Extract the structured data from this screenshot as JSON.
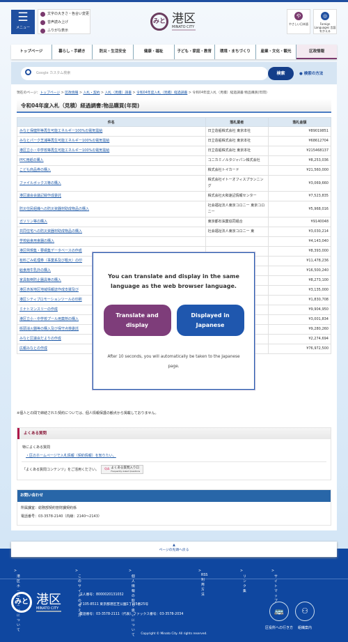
{
  "header": {
    "menu_label": "メニュー",
    "tools": [
      "文字の大きさ・色合い変更",
      "音声読み上げ",
      "ふりがな表示"
    ],
    "logo_name": "港区",
    "logo_sub": "MINATO CITY",
    "easy_japanese": "やさしい日本語",
    "foreign_languages": "Foreign Languages 言語をかえる"
  },
  "nav": [
    "トップページ",
    "暮らし・手続き",
    "防災・生活安全",
    "健康・福祉",
    "子ども・家庭・教育",
    "環境・まちづくり",
    "産業・文化・観光",
    "区政情報"
  ],
  "search": {
    "placeholder": "Google カスタム検索",
    "button": "検索",
    "how": "検索の方法"
  },
  "breadcrumb": {
    "prefix": "現在のページ：",
    "links": [
      "トップページ",
      "区政情報",
      "入札・契約",
      "入札（見積）調書",
      "令和04年度入札（見積）経過調書"
    ],
    "current": "令和04年度入札（見積）経過調書:物品購買(年間)"
  },
  "page_title": "令和04年度入札（見積）経過調書:物品購買(年間)",
  "table": {
    "headers": [
      "件名",
      "落札業者",
      "落札金額"
    ],
    "rows": [
      [
        "みなと保健所等再生可能エネルギー100%の電気需給",
        "日立造船株式会社 東京本社",
        "¥89019851"
      ],
      [
        "みなとパーク芝浦等再生可能エネルギー100%の電気需給",
        "日立造船株式会社 東京本社",
        "¥68612704"
      ],
      [
        "港区立小・中学校等再生可能エネルギー100%の電気需給",
        "日立造船株式会社 東京本社",
        "¥215468137"
      ],
      [
        "PPC用紙の購入",
        "コニカミノルタジャパン株式会社",
        "¥8,253,036"
      ],
      [
        "こども商品券の購入",
        "株式会社トイカード",
        "¥21,560,000"
      ],
      [
        "ファイルボックス等の購入",
        "株式会社イトーオフィスプランニング",
        "¥3,069,660"
      ],
      [
        "港区議会会議記録作成委託",
        "株式会社大和速記情報センター",
        "¥7,523,835"
      ],
      [
        "防災住民組織への防災資器材助成物品の購入",
        "社会福祉法人東京コロニー 東京コロニー",
        "¥5,968,016"
      ],
      [
        "ガソリン等の購入",
        "東京都石油業協同組合",
        "¥9140048"
      ],
      [
        "共同住宅への防災資器材助成物品の購入",
        "社会福祉法人東京コロニー 東",
        "¥3,030,214"
      ],
      [
        "学校給食用食器の購入",
        "",
        "¥4,143,040"
      ],
      [
        "港区例規集・要綱集データベースの作成",
        "",
        "¥8,393,000"
      ],
      [
        "有料ごみ処理券（事業系及び粗大）の印",
        "ミュ",
        "¥11,478,236"
      ],
      [
        "給食用牛乳外の購入",
        "",
        "¥16,500,240"
      ],
      [
        "家具転倒防止器具等の購入",
        "ー 東",
        "¥8,273,100"
      ],
      [
        "港区赤坂地区地域情報誌作成支援及び",
        "ルー",
        "¥3,135,000"
      ],
      [
        "港区シティプロモーションツールの印刷",
        "",
        "¥1,830,708"
      ],
      [
        "ミナトマンスリーの作成",
        "",
        "¥9,904,950"
      ],
      [
        "港区立小・中学校プール用薬剤の購入",
        "",
        "¥3,001,834"
      ],
      [
        "街頭消火器等の購入及び保守点検委託",
        "",
        "¥9,280,260"
      ],
      [
        "みなと区議会だよりの作成",
        "",
        "¥2,274,694"
      ],
      [
        "広報みなとの作成",
        "株式会社報知新聞社 東京本社",
        "¥76,972,500"
      ]
    ]
  },
  "note": "※個人との間で締結された契約については、個人情報保護の観点から掲載しておりません。",
  "faq": {
    "title": "よくある質問",
    "sub": "特によくある質問",
    "link": "区のホームページで入札情報（契約情報）を知りたい。",
    "prompt": "「よくある質問コンテンツ」をご活用ください。",
    "button": "よくある質問入り口",
    "button_sub": "Frequently Asked Questions"
  },
  "contact": {
    "title": "お問い合わせ",
    "dept": "所属課室：総務部契約管財課契約係",
    "phone": "電話番号：03-3578-2140（内線：2140～2143）"
  },
  "back_to_top": "ページの先頭へ戻る",
  "footer": {
    "links": [
      "港区ホームページについて",
      "このサイトの考え方",
      "個人情報の取り扱いについて",
      "RSS利用方法",
      "リンク集",
      "サイトマップ"
    ],
    "corp_no": "法人番号：8000020131032",
    "address": "〒105-8511 東京都港区芝公園1丁目5番25号",
    "tel": "電話番号：03-3578-2111（代表）ファックス番号：03-3578-2034",
    "access": "区役所への行き方",
    "org": "組織案内",
    "copyright": "Copyright © Minato City. All rights reserved."
  },
  "modal": {
    "message": "You can translate and display in the same language as the web browser language.",
    "translate": "Translate and display",
    "japanese": "Displayed in Japanese",
    "note": "After 10 seconds, you will automatically be taken to the Japanese page."
  },
  "colors": {
    "brand_blue": "#1f4fa0",
    "brand_purple": "#7e3d7a",
    "footer": "#0f47a0"
  }
}
